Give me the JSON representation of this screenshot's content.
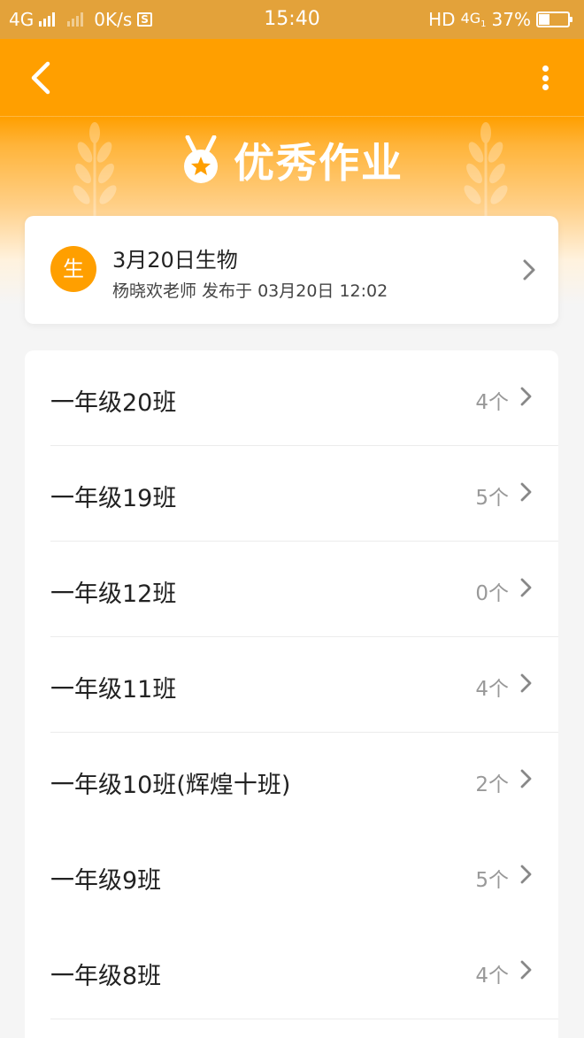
{
  "status_bar": {
    "network_1": "4G",
    "speed": "0K/s",
    "s_label": "S",
    "time": "15:40",
    "hd_label": "HD",
    "network_2": "4G",
    "network_2_sub": "1",
    "battery": "37%",
    "battery_level_percent": 37
  },
  "nav": {
    "back_icon": "chevron-left-icon",
    "more_icon": "more-vertical-icon"
  },
  "banner": {
    "icon": "medal-icon",
    "title": "优秀作业"
  },
  "assignment": {
    "avatar": "生",
    "title": "3月20日生物",
    "subtitle": "杨晓欢老师 发布于 03月20日 12:02"
  },
  "classes": [
    {
      "name": "一年级20班",
      "count": "4个"
    },
    {
      "name": "一年级19班",
      "count": "5个"
    },
    {
      "name": "一年级12班",
      "count": "0个"
    },
    {
      "name": "一年级11班",
      "count": "4个"
    },
    {
      "name": "一年级10班(辉煌十班)",
      "count": "2个"
    },
    {
      "name": "一年级9班",
      "count": "5个"
    },
    {
      "name": "一年级8班",
      "count": "4个"
    }
  ],
  "colors": {
    "brand_orange": "#ff9f00",
    "status_bar": "#e3a23a",
    "text_primary": "#222222",
    "text_secondary": "#999999"
  }
}
